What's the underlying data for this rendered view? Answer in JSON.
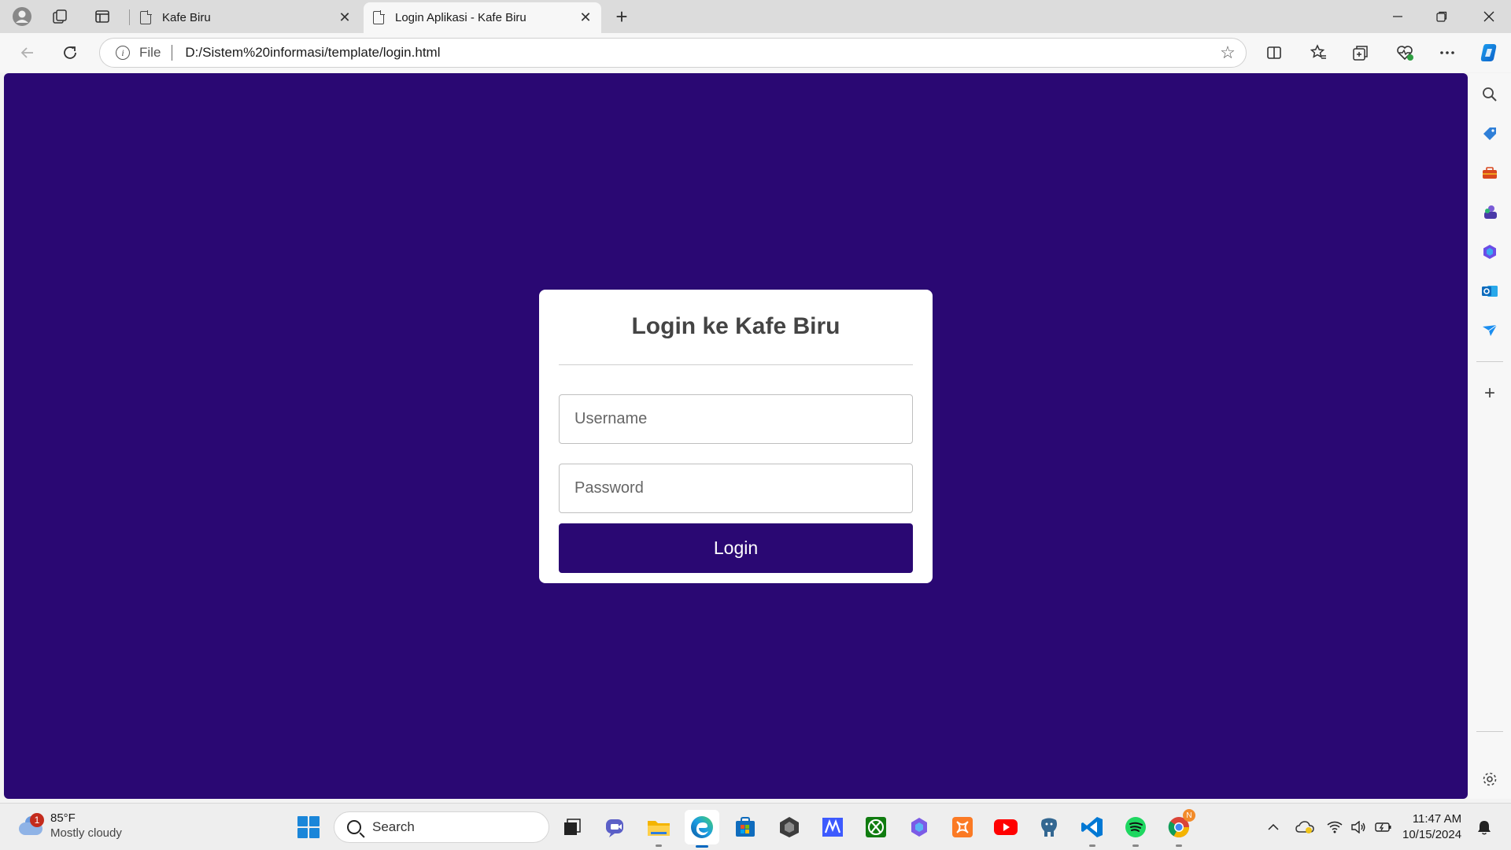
{
  "browser": {
    "tabs": [
      {
        "title": "Kafe Biru",
        "active": false
      },
      {
        "title": "Login Aplikasi - Kafe Biru",
        "active": true
      }
    ],
    "address": {
      "scheme_label": "File",
      "url": "D:/Sistem%20informasi/template/login.html"
    }
  },
  "page": {
    "background": "#2a0873",
    "title": "Login ke Kafe Biru",
    "username_placeholder": "Username",
    "password_placeholder": "Password",
    "login_label": "Login",
    "accent": "#2a0873"
  },
  "sidebar": {
    "icons": [
      "search-icon",
      "tag-icon",
      "toolbox-icon",
      "games-icon",
      "copilot-icon",
      "outlook-icon",
      "send-icon",
      "add-icon",
      "settings-icon"
    ]
  },
  "taskbar": {
    "weather": {
      "badge": "1",
      "temp": "85°F",
      "condition": "Mostly cloudy"
    },
    "search_label": "Search",
    "apps": [
      "task-view",
      "teams",
      "file-explorer",
      "edge",
      "store",
      "unity",
      "app-m",
      "xbox",
      "copilot",
      "xampp",
      "youtube",
      "postgresql",
      "vscode",
      "spotify",
      "chrome"
    ],
    "chrome_badge": "N",
    "clock": {
      "time": "11:47 AM",
      "date": "10/15/2024"
    }
  }
}
